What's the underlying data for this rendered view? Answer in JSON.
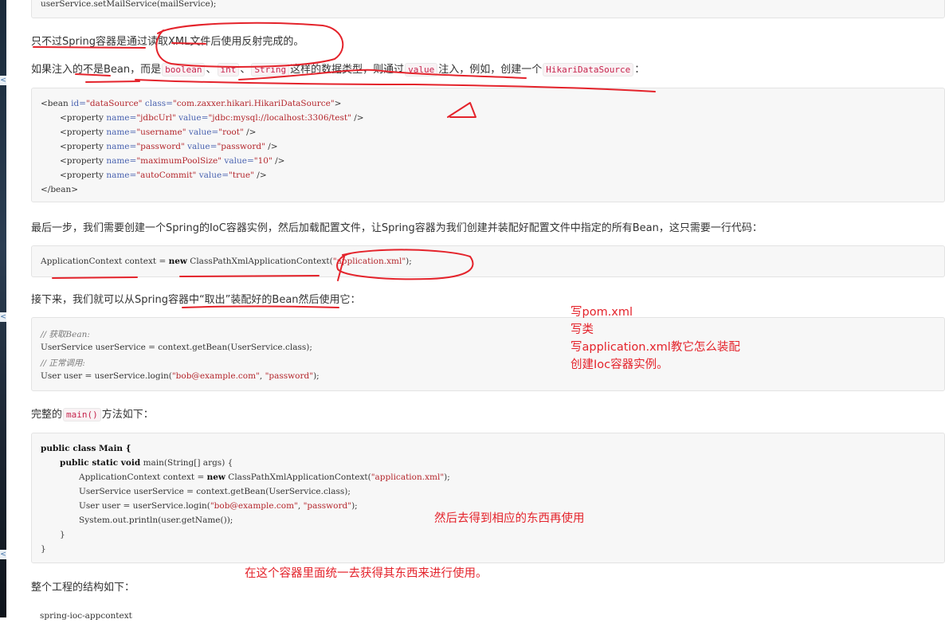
{
  "top_code_line": "userService.setMailService(mailService);",
  "para1": "只不过Spring容器是通过读取XML文件后使用反射完成的。",
  "para2": {
    "a": "如果注入的不是Bean，而是",
    "c1": "boolean",
    "b": "、",
    "c2": "int",
    "c": "、",
    "c3": "String",
    "d": "这样的数据类型，则通过",
    "c4": "value",
    "e": "注入，例如，创建一个",
    "c5": "HikariDataSource",
    "f": "："
  },
  "xml_code": {
    "open_pre": "<bean ",
    "id_attr": "id=",
    "id_val": "\"dataSource\"",
    "class_attr": " class=",
    "class_val": "\"com.zaxxer.hikari.HikariDataSource\"",
    "open_post": ">",
    "props": [
      {
        "name": "\"jdbcUrl\"",
        "value": "\"jdbc:mysql://localhost:3306/test\""
      },
      {
        "name": "\"username\"",
        "value": "\"root\""
      },
      {
        "name": "\"password\"",
        "value": "\"password\""
      },
      {
        "name": "\"maximumPoolSize\"",
        "value": "\"10\""
      },
      {
        "name": "\"autoCommit\"",
        "value": "\"true\""
      }
    ],
    "prop_open": "<property ",
    "name_attr": "name=",
    "value_attr": " value=",
    "prop_close": " />",
    "close": "</bean>"
  },
  "para3": "最后一步，我们需要创建一个Spring的IoC容器实例，然后加载配置文件，让Spring容器为我们创建并装配好配置文件中指定的所有Bean，这只需要一行代码：",
  "ctx_code": {
    "pre": "ApplicationContext context = ",
    "kw": "new",
    "mid": " ClassPathXmlApplicationContext(",
    "str": "\"application.xml\"",
    "post": ");"
  },
  "para4": "接下来，我们就可以从Spring容器中“取出”装配好的Bean然后使用它：",
  "use_code": {
    "c1": "// 获取Bean:",
    "l2": "UserService userService = context.getBean(UserService.class);",
    "c3": "// 正常调用:",
    "l4a": "User user = userService.login(",
    "l4s1": "\"bob@example.com\"",
    "l4b": ", ",
    "l4s2": "\"password\"",
    "l4c": ");"
  },
  "para5": {
    "a": "完整的",
    "c1": "main()",
    "b": "方法如下："
  },
  "main_code": {
    "l1kw": "public class",
    "l1b": " Main {",
    "l2kw": "public static void",
    "l2b": " main(String[] args) {",
    "l3a": "ApplicationContext context = ",
    "l3kw": "new",
    "l3b": " ClassPathXmlApplicationContext(",
    "l3s": "\"application.xml\"",
    "l3c": ");",
    "l4": "UserService userService = context.getBean(UserService.class);",
    "l5a": "User user = userService.login(",
    "l5s1": "\"bob@example.com\"",
    "l5b": ", ",
    "l5s2": "\"password\"",
    "l5c": ");",
    "l6": "System.out.println(user.getName());",
    "l7": "}",
    "l8": "}"
  },
  "para6": "整个工程的结构如下：",
  "bottom_code_line": "spring-ioc-appcontext",
  "notes": {
    "n1": "写pom.xml",
    "n2": "写类",
    "n3": "写application.xml教它怎么装配",
    "n4": "创建Ioc容器实例。",
    "n5": "然后去得到相应的东西再使用",
    "n6": "在这个容器里面统一去获得其东西来进行使用。"
  },
  "sidebar_tabs": [
    "<",
    "<",
    "<"
  ],
  "colors": {
    "annotation": "#e4232b",
    "string": "#b4272d",
    "attribute": "#4a63b0",
    "inline_code": "#c7254e"
  }
}
